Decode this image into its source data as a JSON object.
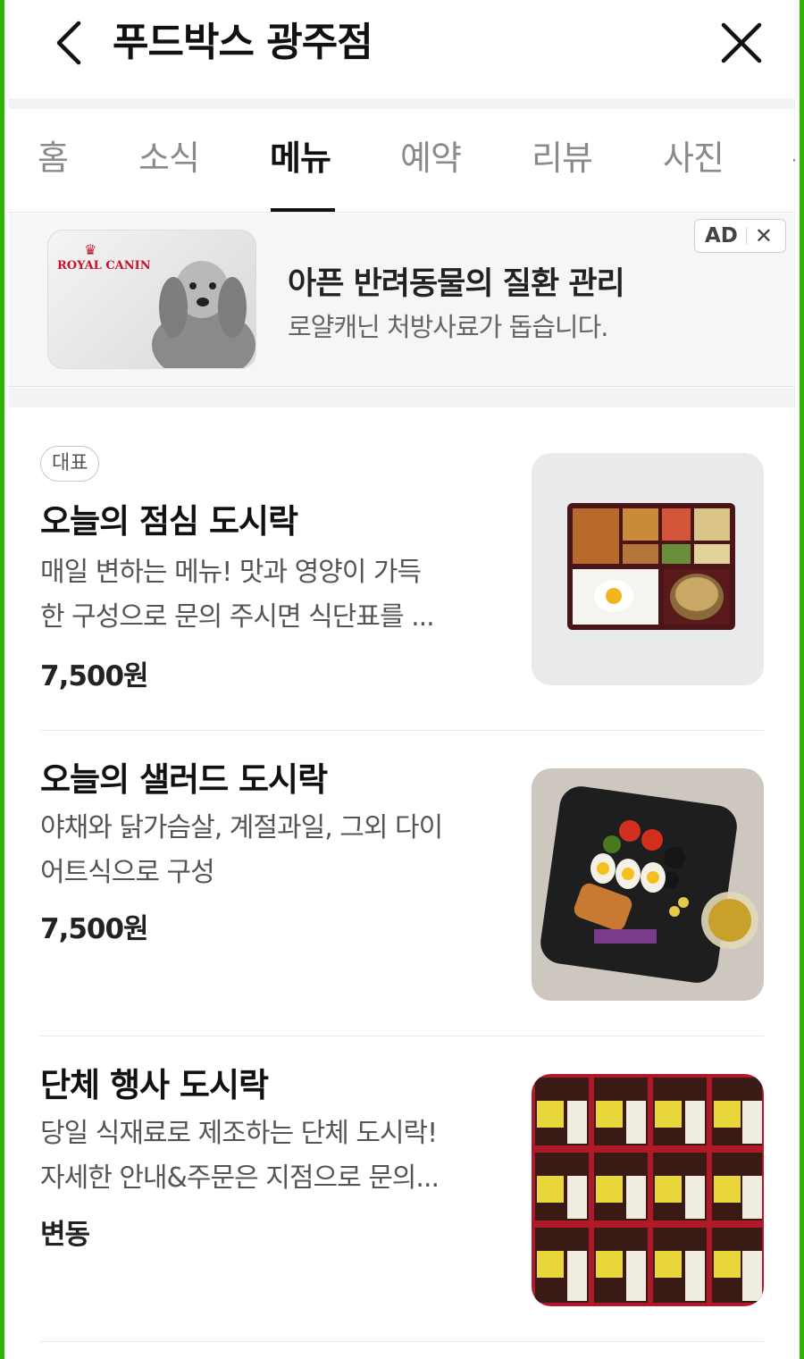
{
  "header": {
    "title": "푸드박스 광주점",
    "back_icon": "chevron-left-icon",
    "close_icon": "close-icon"
  },
  "tabs": [
    {
      "label": "홈",
      "active": false
    },
    {
      "label": "소식",
      "active": false
    },
    {
      "label": "메뉴",
      "active": true
    },
    {
      "label": "예약",
      "active": false
    },
    {
      "label": "리뷰",
      "active": false
    },
    {
      "label": "사진",
      "active": false
    },
    {
      "label": "주",
      "active": false
    }
  ],
  "ad": {
    "logo_text": "ROYAL CANIN",
    "title": "아픈 반려동물의 질환 관리",
    "subtitle": "로얄캐닌 처방사료가 돕습니다.",
    "badge_label": "AD",
    "badge_close": "✕"
  },
  "menu": [
    {
      "badge": "대표",
      "name": "오늘의 점심 도시락",
      "desc": "매일 변하는 메뉴! 맛과 영양이 가득\n한 구성으로 문의 주시면 식단표를 ...",
      "price": "7,500원",
      "image": "lunch-box-photo"
    },
    {
      "badge": "",
      "name": "오늘의 샐러드 도시락",
      "desc": "야채와 닭가슴살, 계절과일, 그외 다이\n어트식으로 구성",
      "price": "7,500원",
      "image": "salad-box-photo"
    },
    {
      "badge": "",
      "name": "단체 행사 도시락",
      "desc": "당일 식재료로 제조하는 단체 도시락!\n자세한 안내&주문은 지점으로 문의...",
      "price": "변동",
      "image": "group-boxes-photo"
    }
  ],
  "colors": {
    "accent_border": "#2db400",
    "brand_red": "#c8102e"
  }
}
